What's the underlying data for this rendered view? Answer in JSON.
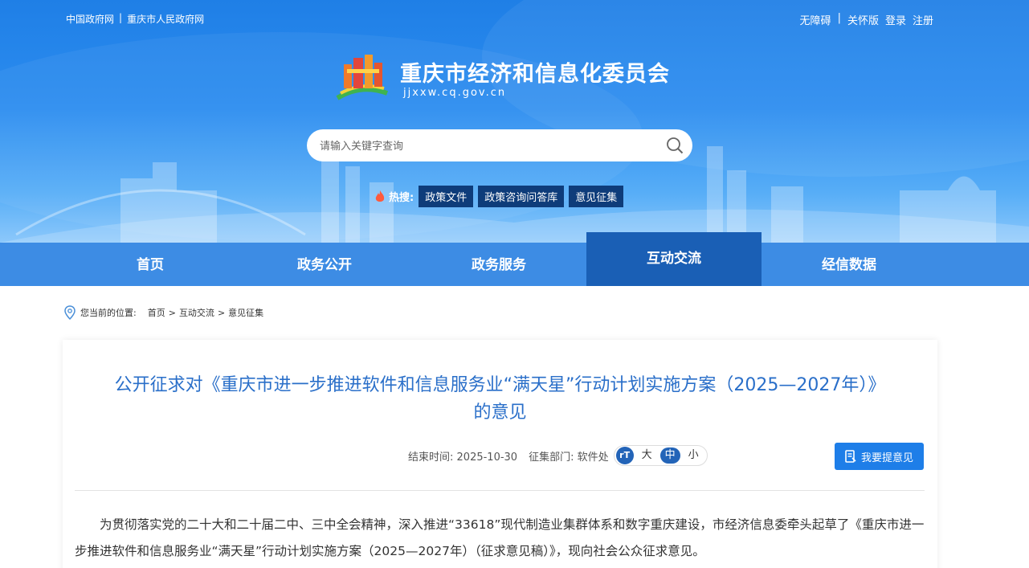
{
  "top_left_links": [
    "中国政府网",
    "重庆市人民政府网"
  ],
  "top_right_links": [
    "无障碍",
    "关怀版",
    "登录",
    "注册"
  ],
  "site": {
    "title": "重庆市经济和信息化委员会",
    "url": "jjxxw.cq.gov.cn"
  },
  "search": {
    "placeholder": "请输入关键字查询"
  },
  "hot": {
    "label": "热搜:",
    "tags": [
      "政策文件",
      "政策咨询问答库",
      "意见征集"
    ]
  },
  "nav": {
    "items": [
      "首页",
      "政务公开",
      "政务服务",
      "互动交流",
      "经信数据"
    ],
    "active": "互动交流"
  },
  "breadcrumb": {
    "prefix": "您当前的位置:",
    "items": [
      "首页",
      "互动交流",
      "意见征集"
    ]
  },
  "article": {
    "title_line1": "公开征求对《重庆市进一步推进软件和信息服务业“满天星”行动计划实施方案（2025—2027年）》",
    "title_line2": "的意见",
    "end_time_label": "结束时间:",
    "end_time": "2025-10-30",
    "dept_label": "征集部门:",
    "dept": "软件处",
    "font_sizes": [
      "大",
      "中",
      "小"
    ],
    "font_size_selected": "中",
    "feedback_button": "我要提意见",
    "body": "为贯彻落实党的二十大和二十届二中、三中全会精神，深入推进“33618”现代制造业集群体系和数字重庆建设，市经济信息委牵头起草了《重庆市进一步推进软件和信息服务业“满天星”行动计划实施方案（2025—2027年）（征求意见稿）》，现向社会公众征求意见。"
  },
  "colors": {
    "banner": "#2c8df0",
    "nav": "#3d8ce4",
    "nav_active": "#1a5fb5",
    "title": "#2a6fc9",
    "button": "#1e7ee8",
    "hot_tag": "#0e3c7a"
  }
}
